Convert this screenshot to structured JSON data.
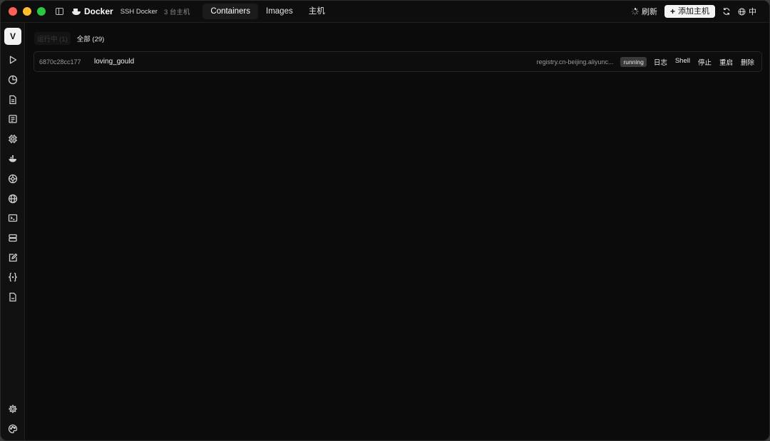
{
  "titlebar": {
    "app_name": "Docker",
    "connection_label": "SSH Docker",
    "host_count": "3 台主机",
    "tabs": [
      {
        "label": "Containers",
        "active": true
      },
      {
        "label": "Images",
        "active": false
      },
      {
        "label": "主机",
        "active": false
      }
    ],
    "refresh_label": "刷新",
    "add_host_label": "添加主机",
    "language_label": "中"
  },
  "rail": {
    "avatar_letter": "V",
    "icons": [
      "play-icon",
      "pie-chart-icon",
      "document-icon",
      "news-icon",
      "cpu-icon",
      "docker-icon",
      "network-icon",
      "globe-icon",
      "terminal-icon",
      "server-icon",
      "edit-icon",
      "code-braces-icon",
      "file-icon"
    ],
    "bottom_icons": [
      "settings-icon",
      "palette-icon"
    ]
  },
  "filters": [
    {
      "label": "运行中 (1)",
      "active": false
    },
    {
      "label": "全部 (29)",
      "active": true
    }
  ],
  "containers": [
    {
      "id": "6870c28cc177",
      "name": "loving_gould",
      "image": "registry.cn-beijing.aliyunc...",
      "status": "running",
      "actions": [
        "日志",
        "Shell",
        "停止",
        "重启",
        "删除"
      ]
    }
  ],
  "colors": {
    "background": "#0b0b0b",
    "rail": "#111111",
    "status_badge": "#3a3a3a",
    "close": "#fe5f57",
    "minimize": "#febc2e",
    "maximize": "#28c840"
  }
}
